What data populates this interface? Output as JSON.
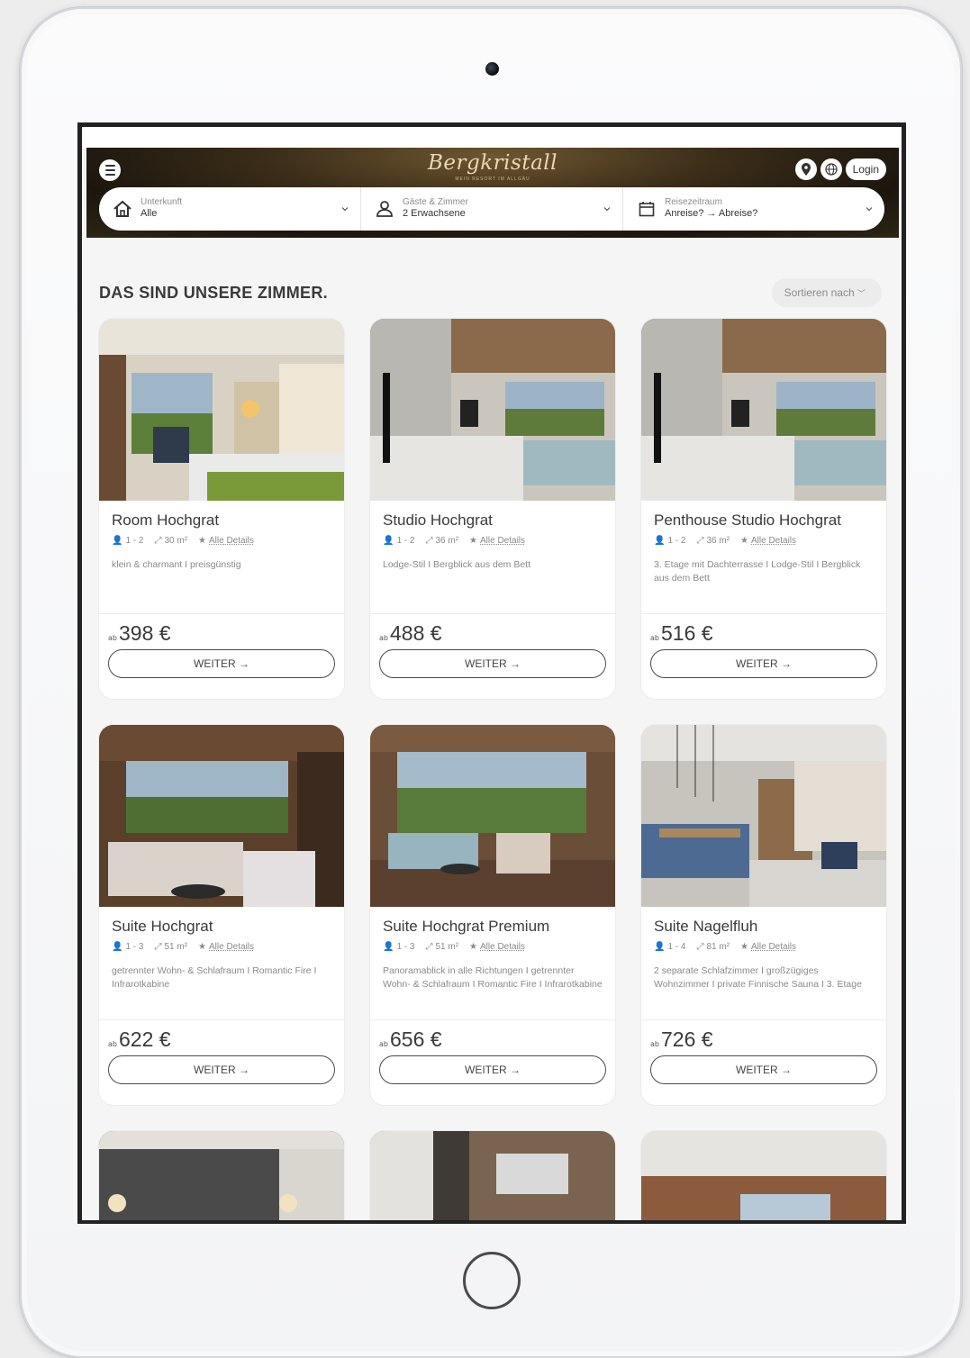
{
  "header": {
    "logo_text": "Bergkristall",
    "logo_subtitle": "MEIN RESORT IM ALLGÄU",
    "login_label": "Login"
  },
  "search": {
    "accommodation": {
      "label": "Unterkunft",
      "value": "Alle"
    },
    "guests": {
      "label": "Gäste & Zimmer",
      "value": "2 Erwachsene"
    },
    "dates": {
      "label": "Reisezeitraum",
      "value": "Anreise? → Abreise?"
    }
  },
  "section": {
    "title": "DAS SIND UNSERE ZIMMER.",
    "sort_label": "Sortieren nach"
  },
  "common": {
    "details_link": "Alle Details",
    "price_prefix": "ab",
    "cta_label": "WEITER →"
  },
  "rooms": [
    {
      "name": "Room Hochgrat",
      "guests": "1 - 2",
      "size": "30 m²",
      "description": "klein & charmant I preisgünstig",
      "price": "398 €"
    },
    {
      "name": "Studio Hochgrat",
      "guests": "1 - 2",
      "size": "36 m²",
      "description": "Lodge-Stil I Bergblick aus dem Bett",
      "price": "488 €"
    },
    {
      "name": "Penthouse Studio Hochgrat",
      "guests": "1 - 2",
      "size": "36 m²",
      "description": "3. Etage mit Dachterrasse I Lodge-Stil I Bergblick aus dem Bett",
      "price": "516 €"
    },
    {
      "name": "Suite Hochgrat",
      "guests": "1 - 3",
      "size": "51 m²",
      "description": "getrennter Wohn- & Schlafraum I Romantic Fire I Infrarotkabine",
      "price": "622 €"
    },
    {
      "name": "Suite Hochgrat Premium",
      "guests": "1 - 3",
      "size": "51 m²",
      "description": "Panoramablick in alle Richtungen I getrennter Wohn- & Schlafraum I Romantic Fire I Infrarotkabine",
      "price": "656 €"
    },
    {
      "name": "Suite Nagelfluh",
      "guests": "1 - 4",
      "size": "81 m²",
      "description": "2 separate Schlafzimmer I großzügiges Wohnzimmer I private Finnische Sauna I 3. Etage",
      "price": "726 €"
    }
  ]
}
